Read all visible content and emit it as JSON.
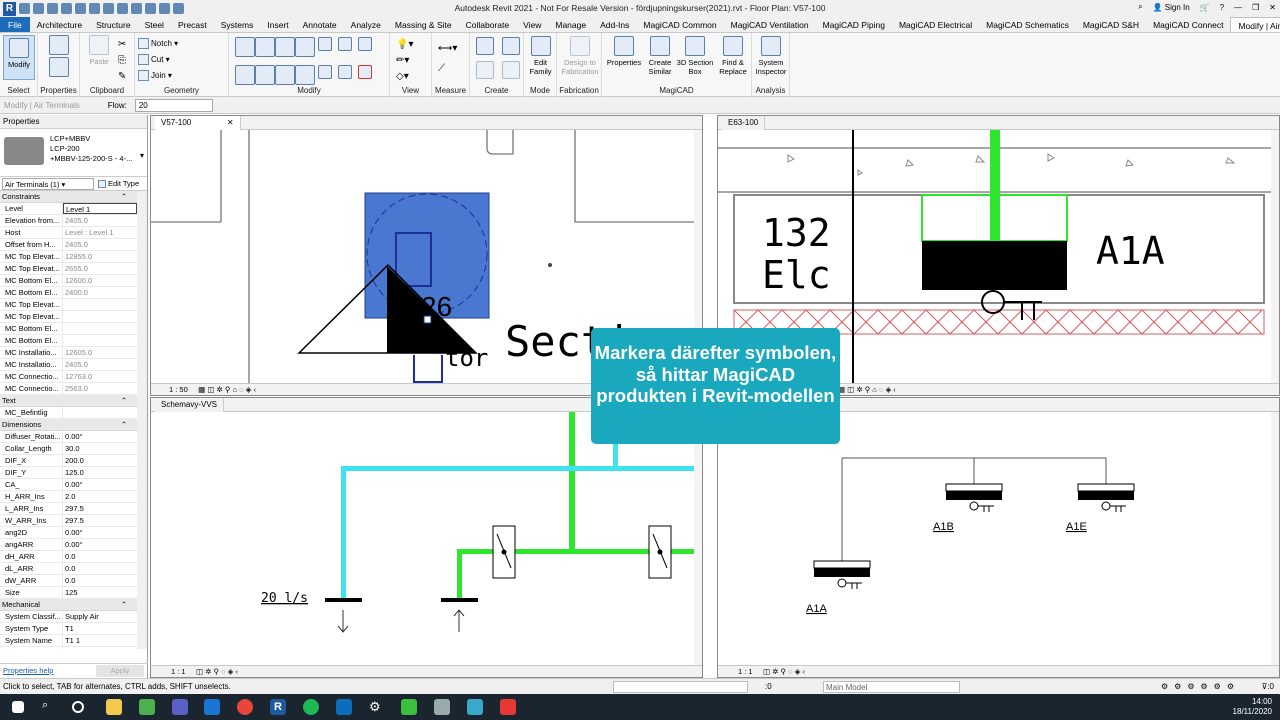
{
  "app": {
    "title": "Autodesk Revit 2021 - Not For Resale Version - fördjupningskurser(2021).rvt - Floor Plan: V57-100",
    "sign_in": "Sign In"
  },
  "tabs": [
    "File",
    "Architecture",
    "Structure",
    "Steel",
    "Precast",
    "Systems",
    "Insert",
    "Annotate",
    "Analyze",
    "Massing & Site",
    "Collaborate",
    "View",
    "Manage",
    "Add-Ins",
    "MagiCAD Common",
    "MagiCAD Ventilation",
    "MagiCAD Piping",
    "MagiCAD Electrical",
    "MagiCAD Schematics",
    "MagiCAD S&H",
    "MagiCAD Connect",
    "Modify | Air Terminals"
  ],
  "ribbon": {
    "modify": "Modify",
    "paste": "Paste",
    "notch": "Notch",
    "cut": "Cut",
    "join": "Join",
    "edit_family": "Edit Family",
    "design_fab": "Design to Fabrication",
    "properties_btn": "Properties",
    "create_similar": "Create Similar",
    "section_box": "3D Section Box",
    "find_replace": "Find & Replace",
    "system_inspector": "System Inspector",
    "panels": {
      "select": "Select",
      "properties": "Properties",
      "clipboard": "Clipboard",
      "geometry": "Geometry",
      "modify": "Modify",
      "view": "View",
      "measure": "Measure",
      "create": "Create",
      "mode": "Mode",
      "fabrication": "Fabrication",
      "magicad": "MagiCAD",
      "analysis": "Analysis"
    }
  },
  "optionbar": {
    "context": "Modify | Air Terminals",
    "flow_label": "Flow:",
    "flow_value": "20"
  },
  "properties": {
    "header": "Properties",
    "type_line1": "LCP+MBBV",
    "type_line2": "LCP-200",
    "type_line3": "+MBBV-125-200-S - 4-...",
    "filter": "Air Terminals (1)",
    "edit_type": "Edit Type",
    "sections": [
      {
        "title": "Constraints",
        "rows": [
          [
            "Level",
            "Level 1"
          ],
          [
            "Elevation from...",
            "2405.0"
          ],
          [
            "Host",
            "Level : Level 1"
          ],
          [
            "Offset from H...",
            "2405.0"
          ],
          [
            "MC Top Elevat...",
            "12855.0"
          ],
          [
            "MC Top Elevat...",
            "2655.0"
          ],
          [
            "MC Bottom El...",
            "12600.0"
          ],
          [
            "MC Bottom El...",
            "2400.0"
          ],
          [
            "MC Top Elevat...",
            ""
          ],
          [
            "MC Top Elevat...",
            ""
          ],
          [
            "MC Bottom El...",
            ""
          ],
          [
            "MC Bottom El...",
            ""
          ],
          [
            "MC Installatio...",
            "12605.0"
          ],
          [
            "MC Installatio...",
            "2405.0"
          ],
          [
            "MC Connectio...",
            "12763.0"
          ],
          [
            "MC Connectio...",
            "2563.0"
          ]
        ]
      },
      {
        "title": "Text",
        "rows": [
          [
            "MC_Befintlig",
            ""
          ]
        ]
      },
      {
        "title": "Dimensions",
        "rows": [
          [
            "Diffuser_Rotati...",
            "0.00°"
          ],
          [
            "Collar_Length",
            "30.0"
          ],
          [
            "DIF_X",
            "200.0"
          ],
          [
            "DIF_Y",
            "125.0"
          ],
          [
            "CA_",
            "0.00°"
          ],
          [
            "H_ARR_Ins",
            "2.0"
          ],
          [
            "L_ARR_Ins",
            "297.5"
          ],
          [
            "W_ARR_Ins",
            "297.5"
          ],
          [
            "ang2D",
            "0.00°"
          ],
          [
            "angARR",
            "0.00°"
          ],
          [
            "dH_ARR",
            "0.0"
          ],
          [
            "dL_ARR",
            "0.0"
          ],
          [
            "dW_ARR",
            "0.0"
          ],
          [
            "Size",
            "125"
          ]
        ]
      },
      {
        "title": "Mechanical",
        "rows": [
          [
            "System Classif...",
            "Supply Air"
          ],
          [
            "System Type",
            "T1"
          ],
          [
            "System Name",
            "T1 1"
          ],
          [
            "System Abbre...",
            "T1"
          ]
        ]
      }
    ],
    "help": "Properties help",
    "apply": "Apply"
  },
  "views": {
    "v1": {
      "tab": "V57-100",
      "scale": "1 : 50",
      "text_section": "Secti",
      "text_tor": "tor",
      "text_26": "26"
    },
    "v2": {
      "tab": "E63-100",
      "room_num": "132",
      "room_name": "Elc",
      "tag": "A1A"
    },
    "v3": {
      "tab": "Schemavy-VVS",
      "scale": "1 : 1",
      "flow": "20 l/s"
    },
    "v4": {
      "scale": "1 : 1",
      "tags": [
        "A1B",
        "A1E",
        "A1A"
      ]
    }
  },
  "callout": "Markera därefter symbolen, så hittar MagiCAD produkten i Revit-modellen",
  "status": {
    "hint": "Click to select, TAB for alternates, CTRL adds, SHIFT unselects.",
    "count": ":0",
    "model": "Main Model"
  },
  "clock": {
    "time": "14:00",
    "date": "18/11/2020"
  }
}
